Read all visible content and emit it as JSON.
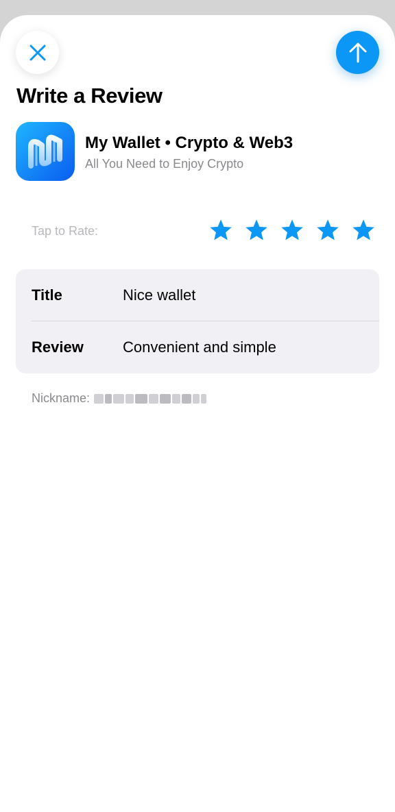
{
  "header": {
    "title": "Write a Review",
    "close_icon": "close-icon",
    "send_icon": "arrow-up-icon"
  },
  "app": {
    "name": "My Wallet • Crypto & Web3",
    "subtitle": "All You Need to Enjoy Crypto",
    "icon": "app-logo-icon"
  },
  "rating": {
    "prompt": "Tap to Rate:",
    "value": 5,
    "max": 5,
    "color": "#0a97f5"
  },
  "form": {
    "title_label": "Title",
    "title_value": "Nice wallet",
    "review_label": "Review",
    "review_value": "Convenient and simple"
  },
  "nickname": {
    "label": "Nickname:"
  },
  "colors": {
    "accent": "#0a97f5",
    "card_bg": "#f1f1f5",
    "secondary_text": "#8a8a8e"
  }
}
